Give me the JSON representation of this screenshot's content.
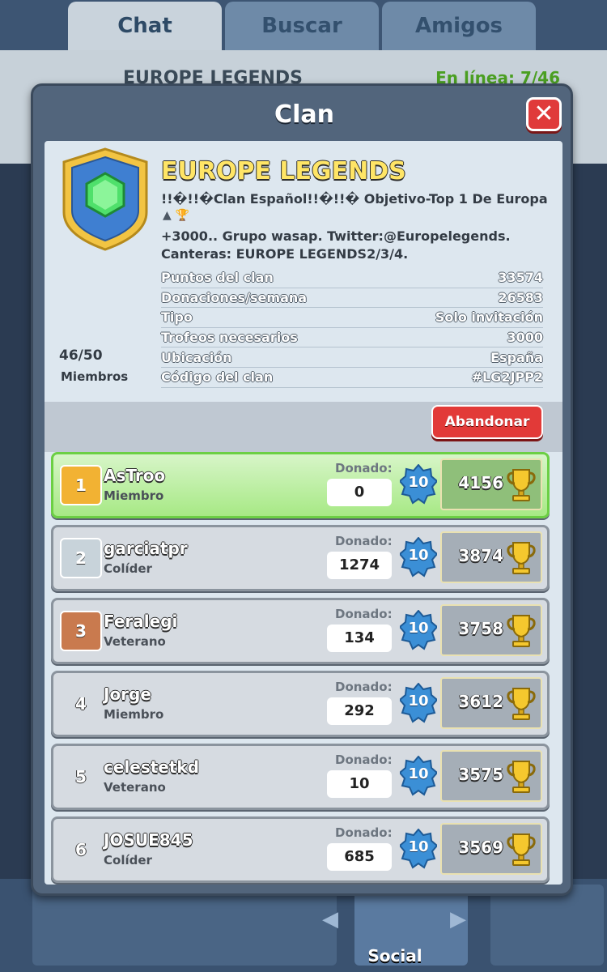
{
  "tabs": [
    {
      "label": "Chat"
    },
    {
      "label": "Buscar"
    },
    {
      "label": "Amigos"
    }
  ],
  "background": {
    "clan_name": "EUROPE LEGENDS",
    "online": "En línea: 7/46"
  },
  "nav": {
    "social_label": "Social"
  },
  "modal": {
    "title": "Clan",
    "clan_name": "EUROPE LEGENDS",
    "description_line1": "!!�!!�Clan Español!!�!!� Objetivo-Top 1 De Europa",
    "description_icons": "▲ 🏆",
    "description_line2": "+3000.. Grupo wasap. Twitter:@Europelegends.",
    "description_line3": "Canteras: EUROPE LEGENDS2/3/4.",
    "stats": [
      {
        "label": "Puntos del clan",
        "value": "33574"
      },
      {
        "label": "Donaciones/semana",
        "value": "26583"
      },
      {
        "label": "Tipo",
        "value": "Solo invitación"
      },
      {
        "label": "Trofeos necesarios",
        "value": "3000"
      },
      {
        "label": "Ubicación",
        "value": "España"
      },
      {
        "label": "Código del clan",
        "value": "#LG2JPP2"
      }
    ],
    "members_count": "46/50",
    "members_label": "Miembros",
    "leave_label": "Abandonar",
    "donated_label": "Donado:",
    "members": [
      {
        "rank": "1",
        "name": "AsTroo",
        "role": "Miembro",
        "donated": "0",
        "level": "10",
        "trophies": "4156"
      },
      {
        "rank": "2",
        "name": "garciatpr",
        "role": "Colíder",
        "donated": "1274",
        "level": "10",
        "trophies": "3874"
      },
      {
        "rank": "3",
        "name": "Feralegi",
        "role": "Veterano",
        "donated": "134",
        "level": "10",
        "trophies": "3758"
      },
      {
        "rank": "4",
        "name": "Jorge",
        "role": "Miembro",
        "donated": "292",
        "level": "10",
        "trophies": "3612"
      },
      {
        "rank": "5",
        "name": "celestetkd",
        "role": "Veterano",
        "donated": "10",
        "level": "10",
        "trophies": "3575"
      },
      {
        "rank": "6",
        "name": "JOSUE845",
        "role": "Colíder",
        "donated": "685",
        "level": "10",
        "trophies": "3569"
      }
    ]
  },
  "colors": {
    "rank_gold": "#f2b233",
    "rank_silver": "#c8d3da",
    "rank_bronze": "#c97a4e",
    "highlight_green": "#a7e985",
    "button_red": "#e23a38"
  }
}
